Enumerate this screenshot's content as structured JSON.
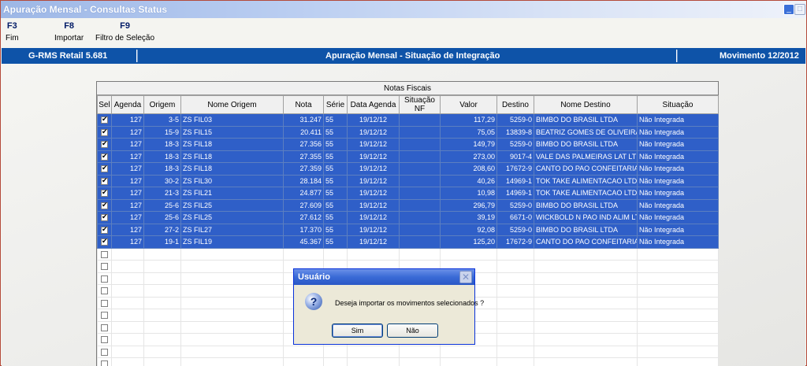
{
  "window": {
    "title": "Apuração Mensal - Consultas Status"
  },
  "toolbar": {
    "items": [
      {
        "key": "F3",
        "label": "Fim"
      },
      {
        "key": "F8",
        "label": "Importar"
      },
      {
        "key": "F9",
        "label": "Filtro de Seleção"
      }
    ]
  },
  "header": {
    "app": "G-RMS Retail 5.681",
    "screen": "Apuração Mensal - Situação de Integração",
    "movimento": "Movimento 12/2012"
  },
  "grid": {
    "caption": "Notas Fiscais",
    "columns": [
      "Sel",
      "Agenda",
      "Origem",
      "Nome Origem",
      "Nota",
      "Série",
      "Data Agenda",
      "Situação NF",
      "Valor",
      "Destino",
      "Nome Destino",
      "Situação"
    ],
    "rows": [
      {
        "agenda": "127",
        "origem": "3-5",
        "nome_origem": "ZS FIL03",
        "nota": "31.247",
        "serie": "55",
        "data": "19/12/12",
        "sit_nf": "",
        "valor": "117,29",
        "destino": "5259-0",
        "nome_destino": "BIMBO DO BRASIL LTDA",
        "situacao": "Não Integrada"
      },
      {
        "agenda": "127",
        "origem": "15-9",
        "nome_origem": "ZS FIL15",
        "nota": "20.411",
        "serie": "55",
        "data": "19/12/12",
        "sit_nf": "",
        "valor": "75,05",
        "destino": "13839-8",
        "nome_destino": "BEATRIZ GOMES DE OLIVEIRA",
        "situacao": "Não Integrada"
      },
      {
        "agenda": "127",
        "origem": "18-3",
        "nome_origem": "ZS FIL18",
        "nota": "27.356",
        "serie": "55",
        "data": "19/12/12",
        "sit_nf": "",
        "valor": "149,79",
        "destino": "5259-0",
        "nome_destino": "BIMBO DO BRASIL LTDA",
        "situacao": "Não Integrada"
      },
      {
        "agenda": "127",
        "origem": "18-3",
        "nome_origem": "ZS FIL18",
        "nota": "27.355",
        "serie": "55",
        "data": "19/12/12",
        "sit_nf": "",
        "valor": "273,00",
        "destino": "9017-4",
        "nome_destino": "VALE DAS PALMEIRAS LAT LTDA",
        "situacao": "Não Integrada"
      },
      {
        "agenda": "127",
        "origem": "18-3",
        "nome_origem": "ZS FIL18",
        "nota": "27.359",
        "serie": "55",
        "data": "19/12/12",
        "sit_nf": "",
        "valor": "208,60",
        "destino": "17672-9",
        "nome_destino": "CANTO DO PAO CONFEITARIA",
        "situacao": "Não Integrada"
      },
      {
        "agenda": "127",
        "origem": "30-2",
        "nome_origem": "ZS FIL30",
        "nota": "28.184",
        "serie": "55",
        "data": "19/12/12",
        "sit_nf": "",
        "valor": "40,26",
        "destino": "14969-1",
        "nome_destino": "TOK TAKE ALIMENTACAO LTDA",
        "situacao": "Não Integrada"
      },
      {
        "agenda": "127",
        "origem": "21-3",
        "nome_origem": "ZS FIL21",
        "nota": "24.877",
        "serie": "55",
        "data": "19/12/12",
        "sit_nf": "",
        "valor": "10,98",
        "destino": "14969-1",
        "nome_destino": "TOK TAKE ALIMENTACAO LTDA",
        "situacao": "Não Integrada"
      },
      {
        "agenda": "127",
        "origem": "25-6",
        "nome_origem": "ZS FIL25",
        "nota": "27.609",
        "serie": "55",
        "data": "19/12/12",
        "sit_nf": "",
        "valor": "296,79",
        "destino": "5259-0",
        "nome_destino": "BIMBO DO BRASIL LTDA",
        "situacao": "Não Integrada"
      },
      {
        "agenda": "127",
        "origem": "25-6",
        "nome_origem": "ZS FIL25",
        "nota": "27.612",
        "serie": "55",
        "data": "19/12/12",
        "sit_nf": "",
        "valor": "39,19",
        "destino": "6671-0",
        "nome_destino": "WICKBOLD N PAO IND ALIM LTDA",
        "situacao": "Não Integrada"
      },
      {
        "agenda": "127",
        "origem": "27-2",
        "nome_origem": "ZS FIL27",
        "nota": "17.370",
        "serie": "55",
        "data": "19/12/12",
        "sit_nf": "",
        "valor": "92,08",
        "destino": "5259-0",
        "nome_destino": "BIMBO DO BRASIL LTDA",
        "situacao": "Não Integrada"
      },
      {
        "agenda": "127",
        "origem": "19-1",
        "nome_origem": "ZS FIL19",
        "nota": "45.367",
        "serie": "55",
        "data": "19/12/12",
        "sit_nf": "",
        "valor": "125,20",
        "destino": "17672-9",
        "nome_destino": "CANTO DO PAO CONFEITARIA",
        "situacao": "Não Integrada"
      }
    ],
    "empty_rows": 10
  },
  "dialog": {
    "title": "Usuário",
    "message": "Deseja importar os movimentos selecionados ?",
    "yes_label": "Sim",
    "no_label": "Não",
    "icon": "question-icon"
  },
  "colors": {
    "header_bar": "#0e53a8",
    "selected_row": "#2f5fc8",
    "dialog_border": "#0831d9"
  }
}
